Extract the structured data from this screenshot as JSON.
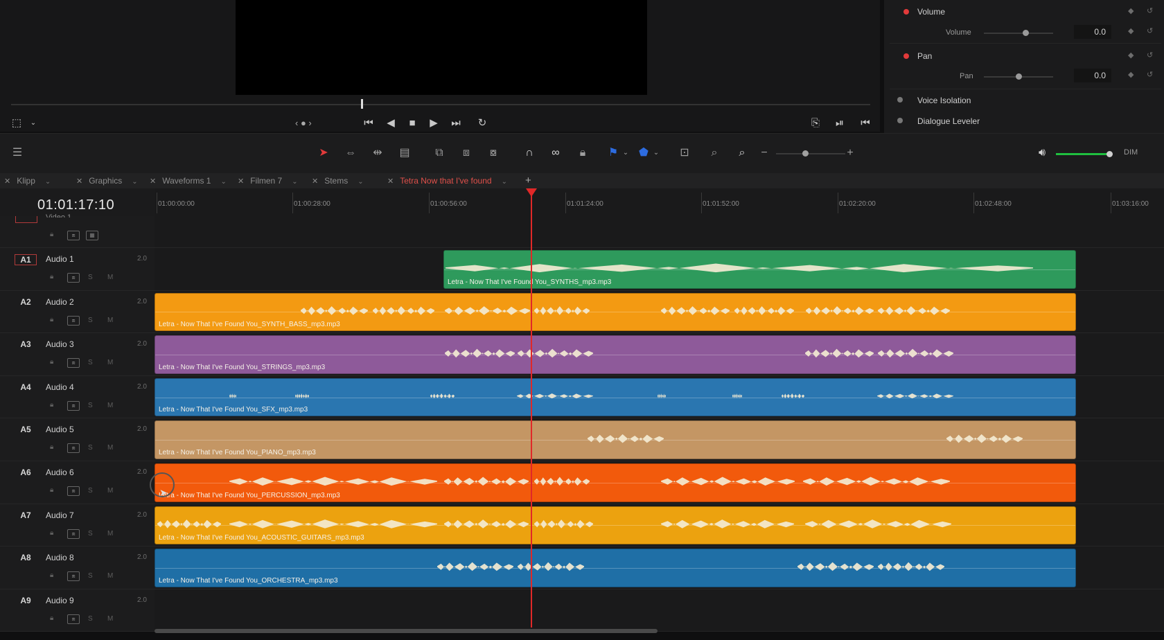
{
  "viewer": {
    "nav_label": "‹ ● ›",
    "icons": [
      "transform-icon",
      "skip-start-icon",
      "step-back-icon",
      "stop-icon",
      "play-icon",
      "skip-end-icon",
      "loop-icon",
      "match-frame-icon",
      "next-edit-icon",
      "prev-edit-icon"
    ]
  },
  "inspector": {
    "volume_label": "Volume",
    "volume_sub_label": "Volume",
    "volume_value": "0.0",
    "volume_level": 0.6,
    "pan_label": "Pan",
    "pan_sub_label": "Pan",
    "pan_value": "0.0",
    "pan_level": 0.5,
    "voice_isolation_label": "Voice Isolation",
    "dialogue_leveler_label": "Dialogue Leveler"
  },
  "toolbar": {
    "dim_label": "DIM",
    "zoom_minus": "−",
    "zoom_plus": "+",
    "accent_color": "#e23a3a",
    "flag_color": "#2d6ce0",
    "volume_color": "#1fbf3f"
  },
  "tabs": [
    {
      "label": "Klipp",
      "active": false
    },
    {
      "label": "Graphics",
      "active": false
    },
    {
      "label": "Waveforms 1",
      "active": false
    },
    {
      "label": "Filmen 7",
      "active": false
    },
    {
      "label": "Stems",
      "active": false
    },
    {
      "label": "Tetra Now that I've found",
      "active": true
    }
  ],
  "add_tab_label": "+",
  "timeline": {
    "timecode": "01:01:17:10",
    "ruler": [
      "01:00:00:00",
      "01:00:28:00",
      "01:00:56:00",
      "01:01:24:00",
      "01:01:52:00",
      "01:02:20:00",
      "01:02:48:00",
      "01:03:16:00"
    ],
    "video_track_label": "Video 1",
    "tracks": [
      {
        "id": "A1",
        "name": "Audio 1",
        "ch": "2.0",
        "clip": "Letra - Now That I've Found You_SYNTHS_mp3.mp3",
        "color": "#2e9a5c"
      },
      {
        "id": "A2",
        "name": "Audio 2",
        "ch": "2.0",
        "clip": "Letra - Now That I've Found You_SYNTH_BASS_mp3.mp3",
        "color": "#f39a12"
      },
      {
        "id": "A3",
        "name": "Audio 3",
        "ch": "2.0",
        "clip": "Letra - Now That I've Found You_STRINGS_mp3.mp3",
        "color": "#8e5a9a"
      },
      {
        "id": "A4",
        "name": "Audio 4",
        "ch": "2.0",
        "clip": "Letra - Now That I've Found You_SFX_mp3.mp3",
        "color": "#2a76b0"
      },
      {
        "id": "A5",
        "name": "Audio 5",
        "ch": "2.0",
        "clip": "Letra - Now That I've Found You_PIANO_mp3.mp3",
        "color": "#c49664"
      },
      {
        "id": "A6",
        "name": "Audio 6",
        "ch": "2.0",
        "clip": "Letra - Now That I've Found You_PERCUSSION_mp3.mp3",
        "color": "#f25a0c"
      },
      {
        "id": "A7",
        "name": "Audio 7",
        "ch": "2.0",
        "clip": "Letra - Now That I've Found You_ACOUSTIC_GUITARS_mp3.mp3",
        "color": "#eca20f"
      },
      {
        "id": "A8",
        "name": "Audio 8",
        "ch": "2.0",
        "clip": "Letra - Now That I've Found You_ORCHESTRA_mp3.mp3",
        "color": "#1f6fa6"
      },
      {
        "id": "A9",
        "name": "Audio 9",
        "ch": "2.0",
        "clip": "",
        "color": ""
      }
    ],
    "solo_label": "S",
    "mute_label": "M"
  }
}
